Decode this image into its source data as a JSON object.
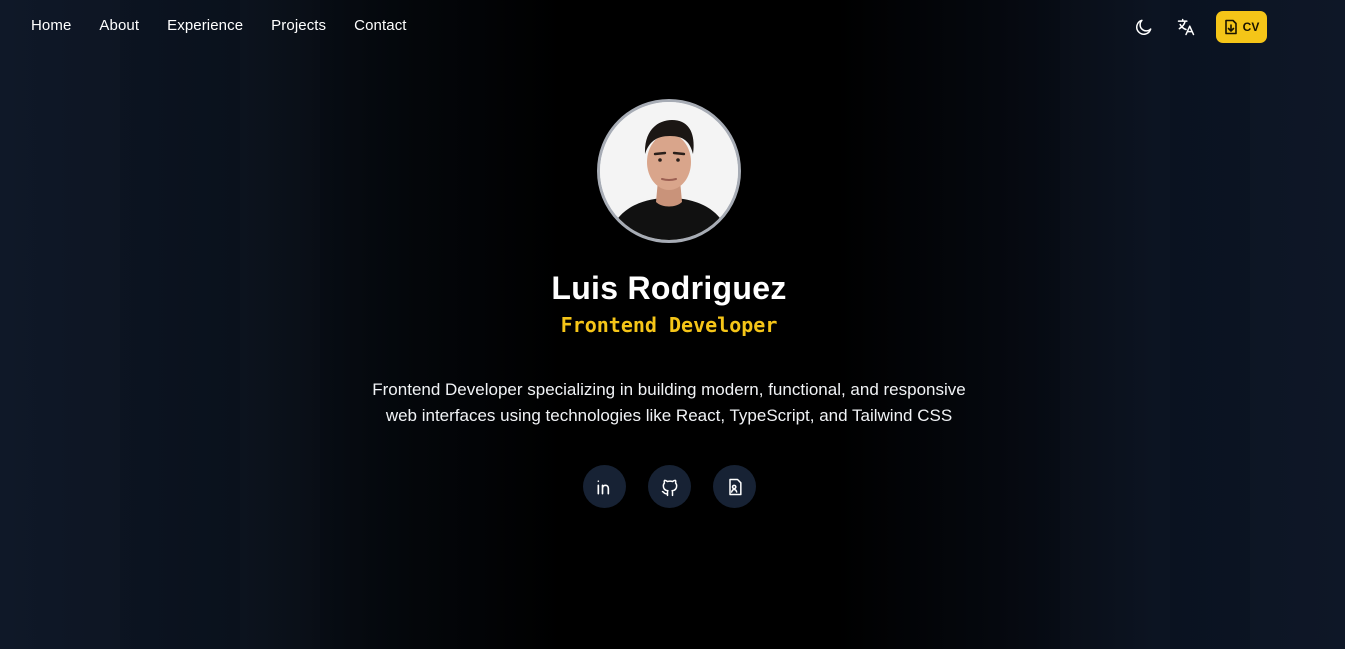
{
  "nav": {
    "links": [
      {
        "label": "Home"
      },
      {
        "label": "About"
      },
      {
        "label": "Experience"
      },
      {
        "label": "Projects"
      },
      {
        "label": "Contact"
      }
    ],
    "theme_icon": "moon-icon",
    "language_icon": "translate-icon",
    "cv_button": {
      "label": "CV",
      "icon": "file-download-icon"
    }
  },
  "hero": {
    "name": "Luis Rodriguez",
    "role": "Frontend Developer",
    "description": "Frontend Developer specializing in building modern, functional, and responsive web interfaces using technologies like React, TypeScript, and Tailwind CSS",
    "socials": [
      {
        "icon": "linkedin-icon"
      },
      {
        "icon": "github-icon"
      },
      {
        "icon": "resume-icon"
      }
    ]
  },
  "colors": {
    "accent": "#f5c518",
    "background": "#000000",
    "social_bg": "#172234",
    "text": "#ffffff"
  }
}
